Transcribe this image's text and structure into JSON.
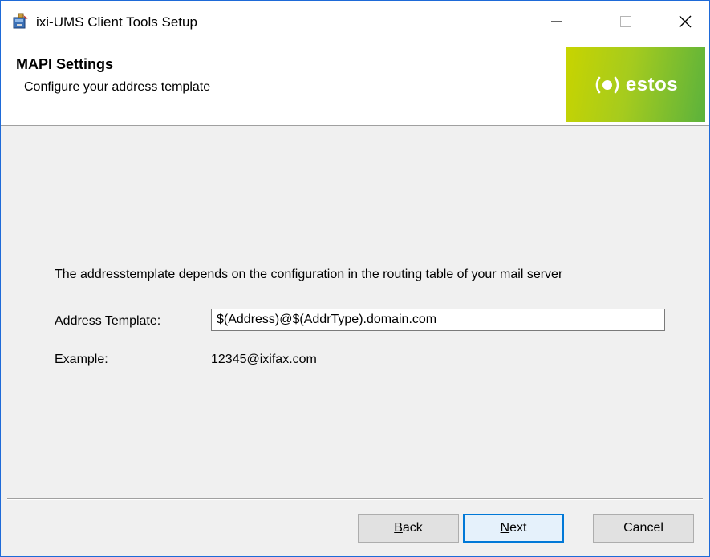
{
  "window": {
    "title": "ixi-UMS Client Tools Setup"
  },
  "banner": {
    "title": "MAPI Settings",
    "subtitle": "Configure your address template",
    "logo_text": "estos",
    "logo_colors": [
      "#c8d400",
      "#5bb23c"
    ]
  },
  "content": {
    "info_text": "The addresstemplate depends on the configuration in the routing table of your mail server",
    "address_label": "Address Template:",
    "address_value": "$(Address)@$(AddrType).domain.com",
    "example_label": "Example:",
    "example_value": "12345@ixifax.com"
  },
  "buttons": {
    "back_mnemonic": "B",
    "back_rest": "ack",
    "next_mnemonic": "N",
    "next_rest": "ext",
    "cancel_label": "Cancel"
  },
  "icons": {
    "app": "installer-icon",
    "minimize": "minimize-icon",
    "maximize": "maximize-icon",
    "close": "close-icon",
    "logo": "estos-logo"
  }
}
